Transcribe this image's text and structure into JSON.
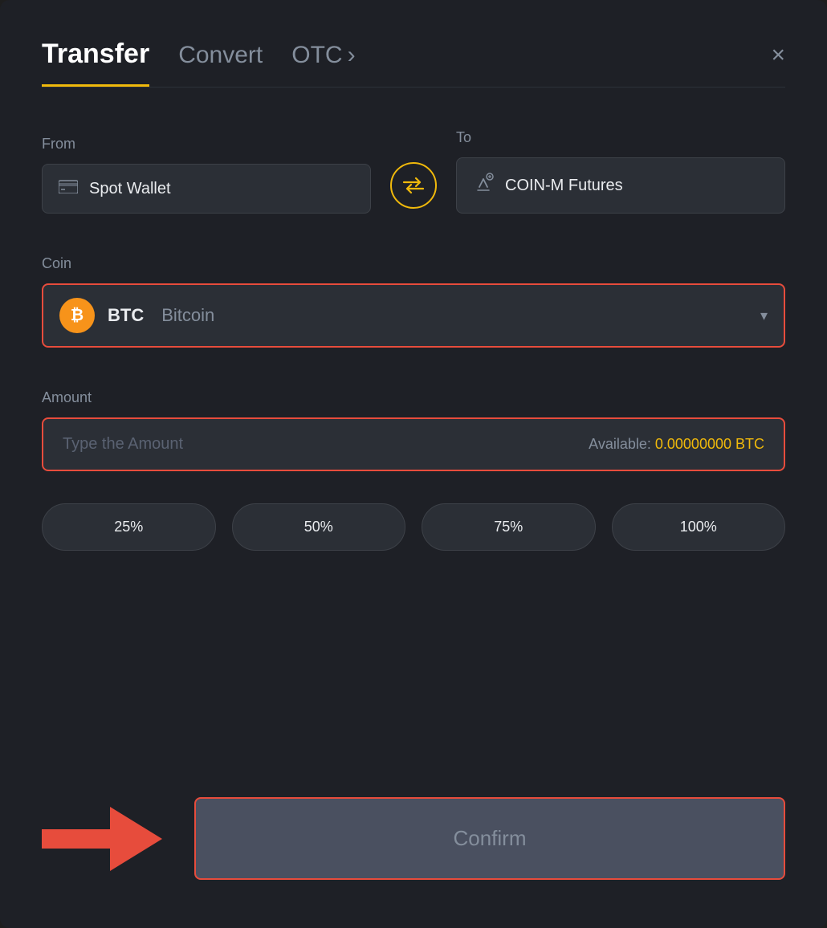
{
  "header": {
    "tab_transfer": "Transfer",
    "tab_convert": "Convert",
    "tab_otc": "OTC",
    "otc_chevron": "›",
    "close_label": "×"
  },
  "from": {
    "label": "From",
    "wallet_icon": "🪪",
    "wallet_name": "Spot Wallet"
  },
  "to": {
    "label": "To",
    "wallet_icon": "↑",
    "wallet_name": "COIN-M Futures"
  },
  "coin": {
    "label": "Coin",
    "symbol": "BTC",
    "name": "Bitcoin",
    "chevron": "▾"
  },
  "amount": {
    "label": "Amount",
    "placeholder": "Type the Amount",
    "available_label": "Available:",
    "available_value": "0.00000000 BTC"
  },
  "percent_buttons": [
    "25%",
    "50%",
    "75%",
    "100%"
  ],
  "confirm_button": "Confirm"
}
